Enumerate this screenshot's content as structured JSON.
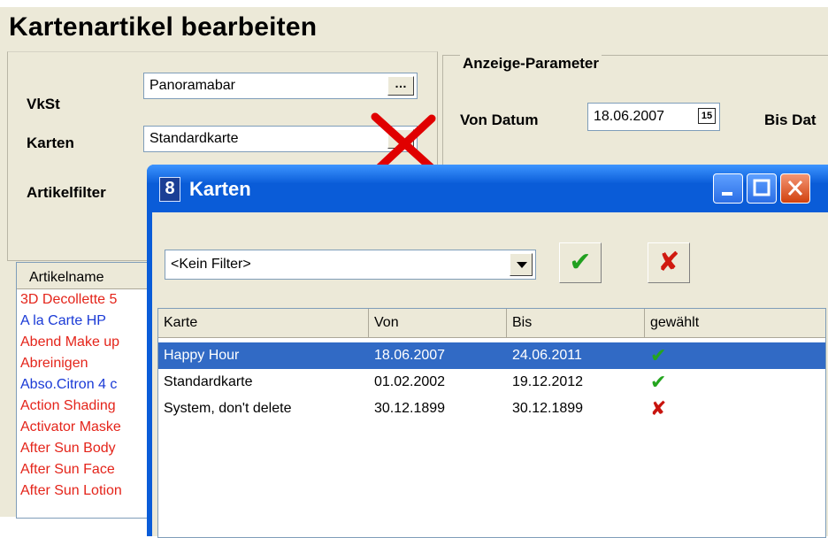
{
  "form": {
    "title": "Kartenartikel bearbeiten",
    "vkst_label": "VkSt",
    "vkst_value": "Panoramabar",
    "karten_label": "Karten",
    "karten_value": "Standardkarte",
    "artikelfilter_label": "Artikelfilter",
    "ellipsis": "…",
    "params": {
      "legend": "Anzeige-Parameter",
      "von_label": "Von Datum",
      "von_value": "18.06.2007",
      "bis_label": "Bis Dat",
      "cal_badge": "15"
    },
    "artikel_list": {
      "header": "Artikelname",
      "items": [
        {
          "text": "3D Decollette 5",
          "color": "#e4241a"
        },
        {
          "text": "A la Carte HP",
          "color": "#1a3ad6"
        },
        {
          "text": "Abend Make up",
          "color": "#e4241a"
        },
        {
          "text": "Abreinigen",
          "color": "#e4241a"
        },
        {
          "text": "Abso.Citron 4 c",
          "color": "#1a3ad6"
        },
        {
          "text": "Action Shading",
          "color": "#e4241a"
        },
        {
          "text": "Activator Maske",
          "color": "#e4241a"
        },
        {
          "text": "After Sun Body",
          "color": "#e4241a"
        },
        {
          "text": "After Sun Face",
          "color": "#e4241a"
        },
        {
          "text": "After Sun Lotion",
          "color": "#e4241a"
        }
      ]
    }
  },
  "dialog": {
    "title": "Karten",
    "app_icon": "8",
    "filter_value": "<Kein Filter>",
    "ok_glyph": "✔",
    "cancel_glyph": "✘",
    "columns": [
      "Karte",
      "Von",
      "Bis",
      "gewählt"
    ],
    "rows": [
      {
        "karte": "Happy Hour",
        "von": "18.06.2007",
        "bis": "24.06.2011",
        "gewaehlt": "ok",
        "selected": true
      },
      {
        "karte": "Standardkarte",
        "von": "01.02.2002",
        "bis": "19.12.2012",
        "gewaehlt": "ok",
        "selected": false
      },
      {
        "karte": "System, don't delete",
        "von": "30.12.1899",
        "bis": "30.12.1899",
        "gewaehlt": "no",
        "selected": false
      }
    ]
  }
}
